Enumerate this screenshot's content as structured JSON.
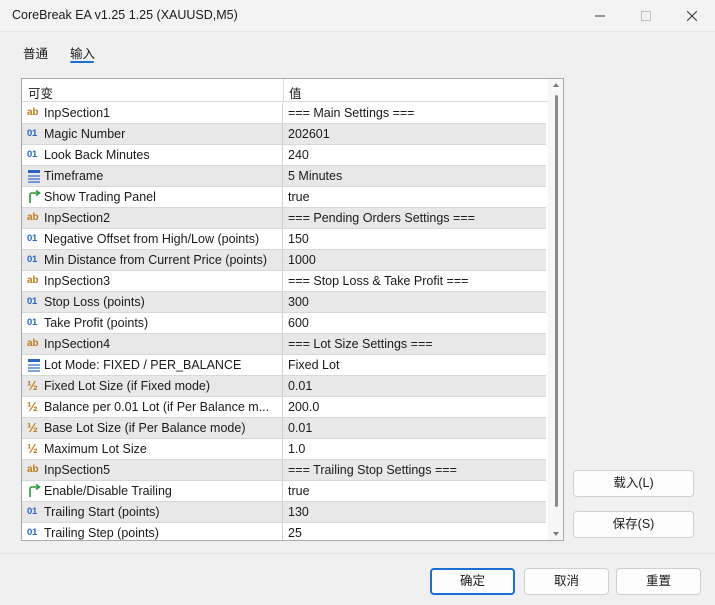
{
  "window": {
    "title": "CoreBreak EA v1.25 1.25 (XAUUSD,M5)"
  },
  "tabs": {
    "general": "普通",
    "inputs": "输入"
  },
  "grid": {
    "header_variable": "可变",
    "header_value": "值",
    "rows": [
      {
        "type": "text",
        "icon": "ab",
        "name": "InpSection1",
        "value": "=== Main Settings ==="
      },
      {
        "type": "int",
        "icon": "01",
        "name": "Magic Number",
        "value": "202601"
      },
      {
        "type": "int",
        "icon": "01",
        "name": "Look Back Minutes",
        "value": "240"
      },
      {
        "type": "enum",
        "icon": "enum-list-icon",
        "name": "Timeframe",
        "value": "5 Minutes"
      },
      {
        "type": "bool",
        "icon": "bool-arrow-icon",
        "name": "Show Trading Panel",
        "value": "true"
      },
      {
        "type": "text",
        "icon": "ab",
        "name": "InpSection2",
        "value": "=== Pending Orders Settings ==="
      },
      {
        "type": "int",
        "icon": "01",
        "name": "Negative Offset from High/Low (points)",
        "value": "150"
      },
      {
        "type": "int",
        "icon": "01",
        "name": "Min Distance from Current Price (points)",
        "value": "1000"
      },
      {
        "type": "text",
        "icon": "ab",
        "name": "InpSection3",
        "value": "=== Stop Loss & Take Profit ==="
      },
      {
        "type": "int",
        "icon": "01",
        "name": "Stop Loss (points)",
        "value": "300"
      },
      {
        "type": "int",
        "icon": "01",
        "name": "Take Profit (points)",
        "value": "600"
      },
      {
        "type": "text",
        "icon": "ab",
        "name": "InpSection4",
        "value": "=== Lot Size Settings ==="
      },
      {
        "type": "enum",
        "icon": "enum-list-icon",
        "name": "Lot Mode: FIXED / PER_BALANCE",
        "value": "Fixed Lot"
      },
      {
        "type": "double",
        "icon": "½",
        "name": "Fixed Lot Size (if Fixed mode)",
        "value": "0.01"
      },
      {
        "type": "double",
        "icon": "½",
        "name": "Balance per 0.01 Lot (if Per Balance m...",
        "value": "200.0"
      },
      {
        "type": "double",
        "icon": "½",
        "name": "Base Lot Size (if Per Balance mode)",
        "value": "0.01"
      },
      {
        "type": "double",
        "icon": "½",
        "name": "Maximum Lot Size",
        "value": "1.0"
      },
      {
        "type": "text",
        "icon": "ab",
        "name": "InpSection5",
        "value": "=== Trailing Stop Settings ==="
      },
      {
        "type": "bool",
        "icon": "bool-arrow-icon",
        "name": "Enable/Disable Trailing",
        "value": "true"
      },
      {
        "type": "int",
        "icon": "01",
        "name": "Trailing Start (points)",
        "value": "130"
      },
      {
        "type": "int",
        "icon": "01",
        "name": "Trailing Step (points)",
        "value": "25"
      }
    ]
  },
  "side_buttons": {
    "load": "载入(L)",
    "save": "保存(S)"
  },
  "dialog_buttons": {
    "ok": "确定",
    "cancel": "取消",
    "reset": "重置"
  },
  "colors": {
    "accent": "#1a6fd1",
    "text_icon": "#c07a18",
    "number_icon": "#2a66c8",
    "bool_icon": "#2a9a3a",
    "row_alt": "#e8e8e8"
  }
}
